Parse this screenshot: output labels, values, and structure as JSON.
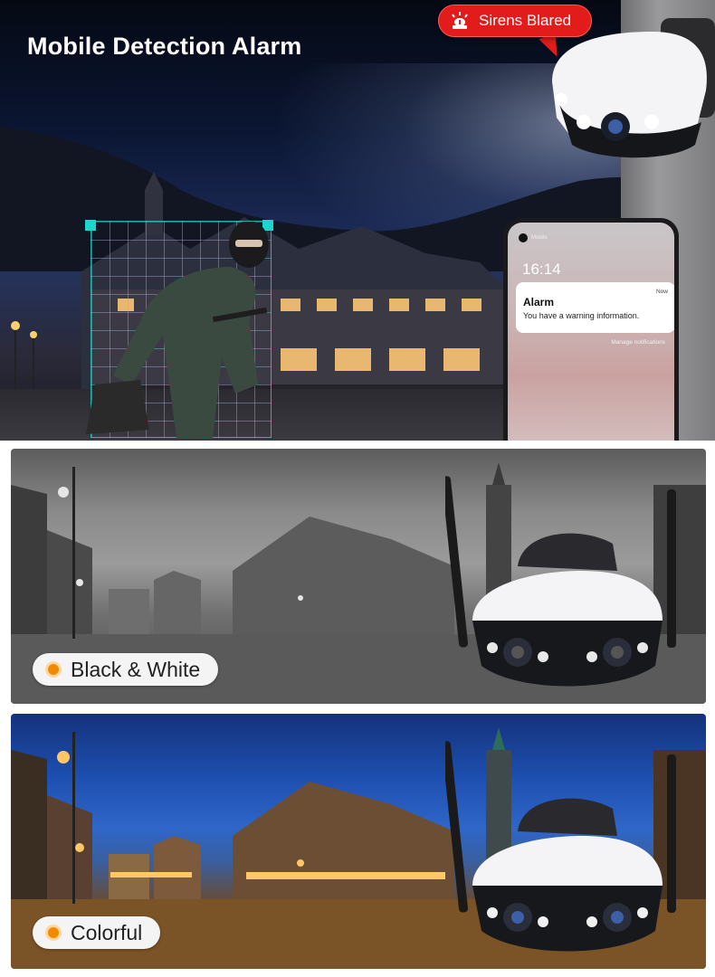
{
  "top_panel": {
    "title": "Mobile Detection Alarm",
    "siren_badge": {
      "label": "Sirens Blared",
      "icon": "siren-icon",
      "color": "#e21b1b"
    },
    "phone": {
      "status_text": "Mobile",
      "time": "16:14",
      "notification": {
        "time": "Now",
        "title": "Alarm",
        "body": "You have a warning information."
      },
      "manage_link": "Manage notifications"
    },
    "detection_box_color": "#19d6cf"
  },
  "modes": [
    {
      "label": "Black & White",
      "indicator_color": "#f28a00"
    },
    {
      "label": "Colorful",
      "indicator_color": "#f28a00"
    }
  ]
}
